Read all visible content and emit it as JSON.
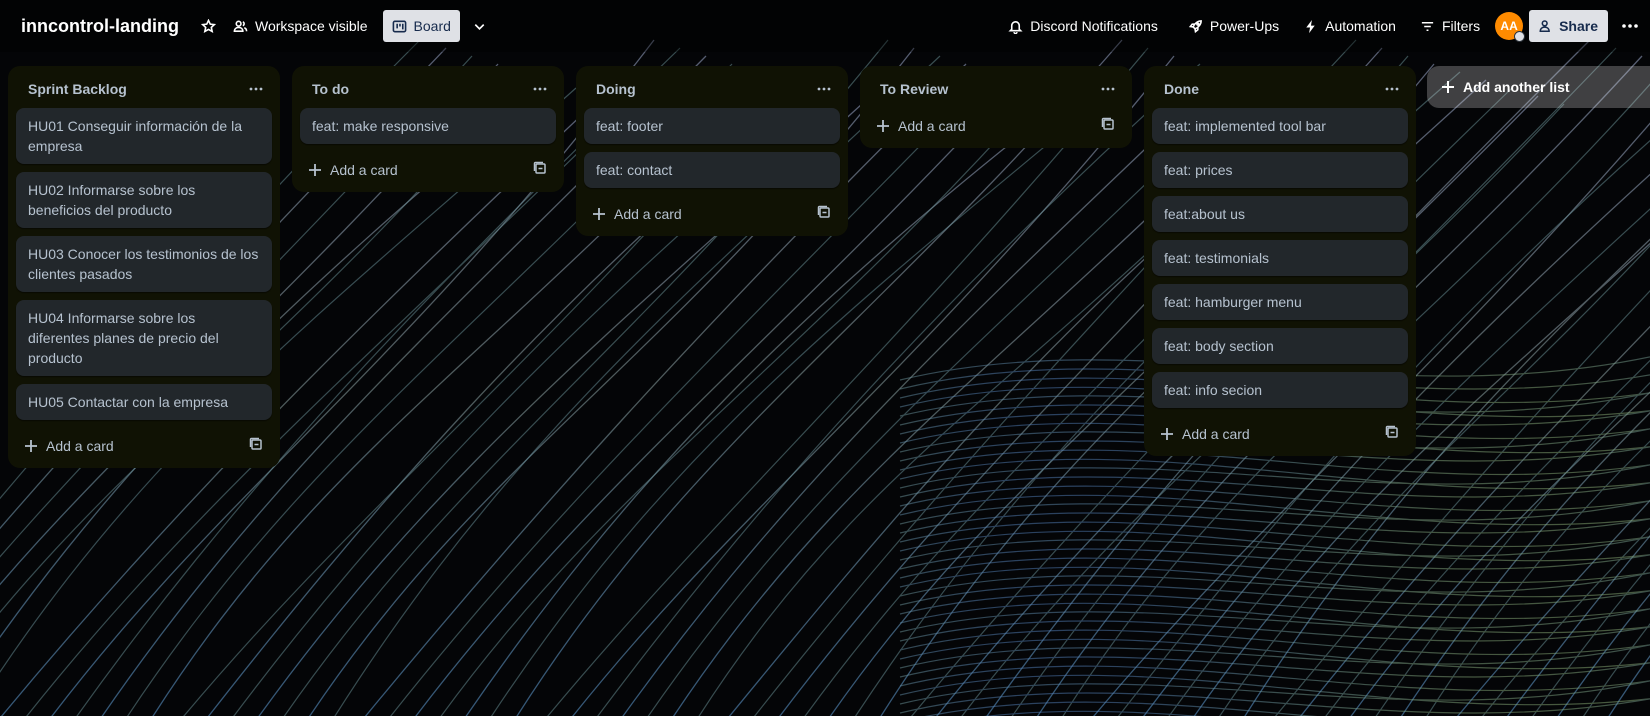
{
  "header": {
    "board_title": "inncontrol-landing",
    "visibility_label": "Workspace visible",
    "view_label": "Board",
    "discord_label": "Discord Notifications",
    "powerups_label": "Power-Ups",
    "automation_label": "Automation",
    "filters_label": "Filters",
    "avatar_initials": "AA",
    "share_label": "Share"
  },
  "lists": [
    {
      "title": "Sprint Backlog",
      "cards": [
        "HU01 Conseguir información de la empresa",
        "HU02 Informarse sobre los beneficios del producto",
        "HU03 Conocer los testimonios de los clientes pasados",
        "HU04 Informarse sobre los diferentes planes de precio del producto",
        "HU05 Contactar con la empresa"
      ],
      "add_label": "Add a card"
    },
    {
      "title": "To do",
      "cards": [
        "feat: make responsive"
      ],
      "add_label": "Add a card"
    },
    {
      "title": "Doing",
      "cards": [
        "feat: footer",
        "feat: contact"
      ],
      "add_label": "Add a card"
    },
    {
      "title": "To Review",
      "cards": [],
      "add_label": "Add a card"
    },
    {
      "title": "Done",
      "cards": [
        "feat: implemented tool bar",
        "feat: prices",
        "feat:about us",
        "feat: testimonials",
        "feat: hamburger menu",
        "feat: body section",
        "feat: info secion"
      ],
      "add_label": "Add a card"
    }
  ],
  "add_list_label": "Add another list",
  "colors": {
    "list_bg": "#101204",
    "card_bg": "#22272b",
    "text": "#b6c2cf",
    "avatar": "#ff8b00",
    "header_button_active": "#dfe1e6"
  }
}
